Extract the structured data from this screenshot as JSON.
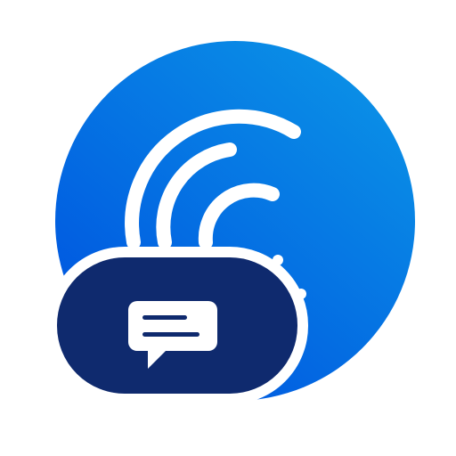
{
  "icon": {
    "name": "chat-signal-app-icon",
    "glyph": "speech-bubble-icon",
    "waves": "signal-waves-icon"
  },
  "colors": {
    "background": "#ffffff",
    "circle_gradient_start": "#0a8fe6",
    "circle_gradient_end": "#0057e0",
    "pill_fill": "#0f2a6e",
    "outline": "#ffffff",
    "bubble_fill": "#ffffff",
    "bubble_lines": "#0f2a6e"
  }
}
